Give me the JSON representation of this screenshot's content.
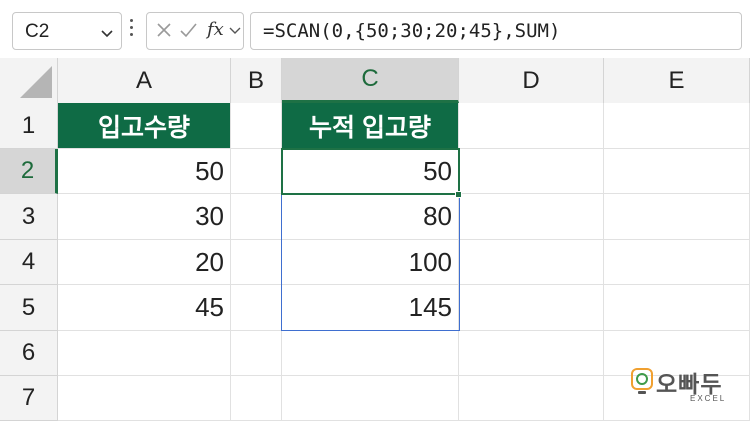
{
  "formula_bar": {
    "name_box": "C2",
    "cancel_icon": "x-icon",
    "enter_icon": "check-icon",
    "fx_label": "fx",
    "formula": "=SCAN(0,{50;30;20;45},SUM)"
  },
  "columns": [
    "A",
    "B",
    "C",
    "D",
    "E"
  ],
  "rows": [
    "1",
    "2",
    "3",
    "4",
    "5",
    "6",
    "7"
  ],
  "selected": {
    "column": "C",
    "row": "2"
  },
  "cells": {
    "A1": "입고수량",
    "A2": "50",
    "A3": "30",
    "A4": "20",
    "A5": "45",
    "C1": "누적 입고량",
    "C2": "50",
    "C3": "80",
    "C4": "100",
    "C5": "145"
  },
  "logo": {
    "brand": "오빠두",
    "sub": "EXCEL"
  },
  "colors": {
    "header_fill": "#0f6b45",
    "selection": "#1e7145",
    "spill_border": "#3f6fd0"
  }
}
